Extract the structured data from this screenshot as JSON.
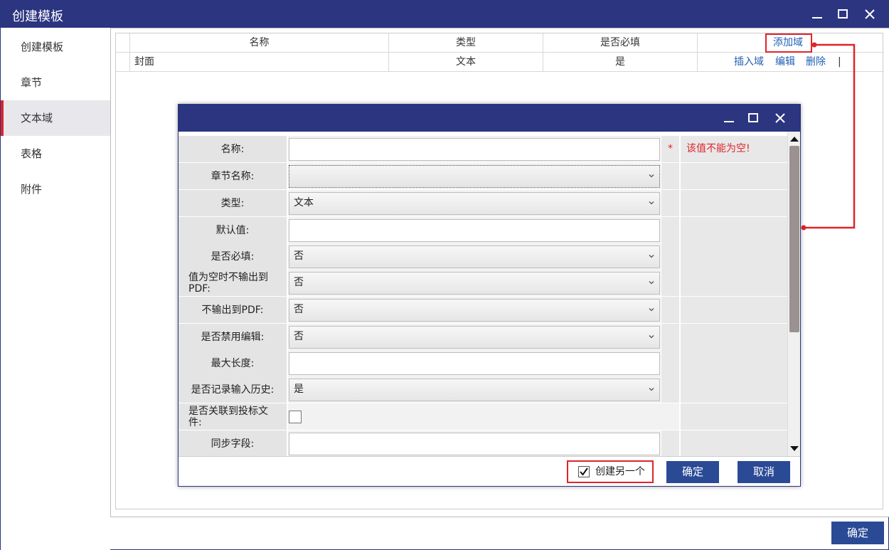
{
  "window": {
    "title": "创建模板"
  },
  "sidebar": {
    "items": [
      {
        "label": "创建模板"
      },
      {
        "label": "章节"
      },
      {
        "label": "文本域"
      },
      {
        "label": "表格"
      },
      {
        "label": "附件"
      }
    ],
    "active_index": 2
  },
  "grid": {
    "columns": [
      "名称",
      "类型",
      "是否必填"
    ],
    "add_label": "添加域",
    "rows": [
      {
        "name": "封面",
        "type": "文本",
        "required": "是",
        "actions": [
          "插入域",
          "编辑",
          "删除"
        ]
      }
    ]
  },
  "dialog": {
    "fields": [
      {
        "label": "名称:",
        "kind": "input",
        "value": "",
        "required_mark": "*",
        "error": "该值不能为空!"
      },
      {
        "label": "章节名称:",
        "kind": "select",
        "value": ""
      },
      {
        "label": "类型:",
        "kind": "select",
        "value": "文本"
      },
      {
        "label": "默认值:",
        "kind": "input",
        "value": ""
      },
      {
        "label": "是否必填:",
        "kind": "select",
        "value": "否"
      },
      {
        "label": "值为空时不输出到PDF:",
        "kind": "select",
        "value": "否"
      },
      {
        "label": "不输出到PDF:",
        "kind": "select",
        "value": "否"
      },
      {
        "label": "是否禁用编辑:",
        "kind": "select",
        "value": "否"
      },
      {
        "label": "最大长度:",
        "kind": "input",
        "value": ""
      },
      {
        "label": "是否记录输入历史:",
        "kind": "select",
        "value": "是"
      },
      {
        "label": "是否关联到投标文件:",
        "kind": "checkbox",
        "checked": false
      },
      {
        "label": "同步字段:",
        "kind": "input",
        "value": ""
      }
    ],
    "footer": {
      "create_another_label": "创建另一个",
      "create_another_checked": true,
      "ok_label": "确定",
      "cancel_label": "取消"
    }
  },
  "main_footer": {
    "ok_label": "确定"
  },
  "colors": {
    "title_bar": "#2b3580",
    "primary_button": "#2b4a96",
    "highlight": "#e0242a",
    "link": "#1f5fb5"
  }
}
